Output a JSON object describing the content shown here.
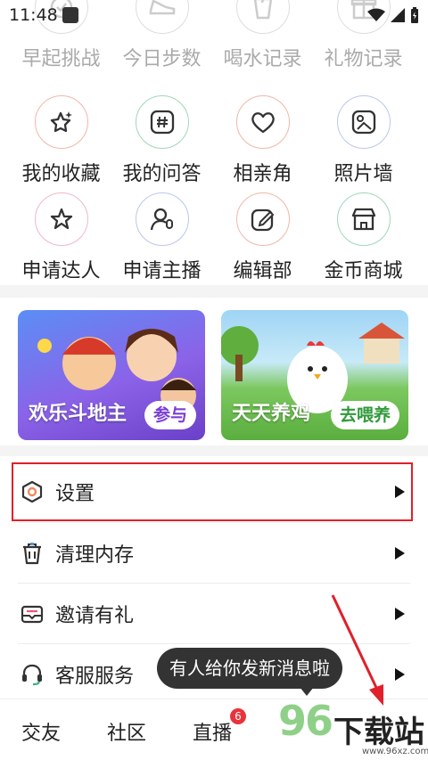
{
  "status_bar": {
    "time": "11:48"
  },
  "grid_rows": [
    {
      "items": [
        {
          "label": "早起挑战",
          "icon": "clock-check-icon"
        },
        {
          "label": "今日步数",
          "icon": "sneaker-icon"
        },
        {
          "label": "喝水记录",
          "icon": "cup-icon"
        },
        {
          "label": "礼物记录",
          "icon": "gift-icon"
        }
      ]
    },
    {
      "items": [
        {
          "label": "我的收藏",
          "icon": "star-sparkle-icon"
        },
        {
          "label": "我的问答",
          "icon": "hashtag-icon"
        },
        {
          "label": "相亲角",
          "icon": "heart-icon"
        },
        {
          "label": "照片墙",
          "icon": "photo-icon"
        }
      ]
    },
    {
      "items": [
        {
          "label": "申请达人",
          "icon": "star-icon"
        },
        {
          "label": "申请主播",
          "icon": "mic-person-icon"
        },
        {
          "label": "编辑部",
          "icon": "edit-icon"
        },
        {
          "label": "金币商城",
          "icon": "shop-icon"
        }
      ]
    }
  ],
  "banners": [
    {
      "title": "欢乐斗地主",
      "action": "参与"
    },
    {
      "title": "天天养鸡",
      "action": "去喂养"
    }
  ],
  "menu": [
    {
      "label": "设置",
      "icon": "settings-hexagon-icon"
    },
    {
      "label": "清理内存",
      "icon": "trash-icon"
    },
    {
      "label": "邀请有礼",
      "icon": "envelope-icon"
    },
    {
      "label": "客服服务",
      "icon": "headset-icon"
    }
  ],
  "toast": "有人给你发新消息啦",
  "bottom_nav": [
    {
      "label": "交友"
    },
    {
      "label": "社区"
    },
    {
      "label": "直播",
      "badge": "6"
    }
  ],
  "watermark": {
    "number": "96",
    "text": "下载站",
    "url": "www.96xz.com"
  },
  "colors": {
    "highlight": "#e0202a",
    "badge": "#e8333c",
    "accent_orange": "#f08a5d"
  }
}
